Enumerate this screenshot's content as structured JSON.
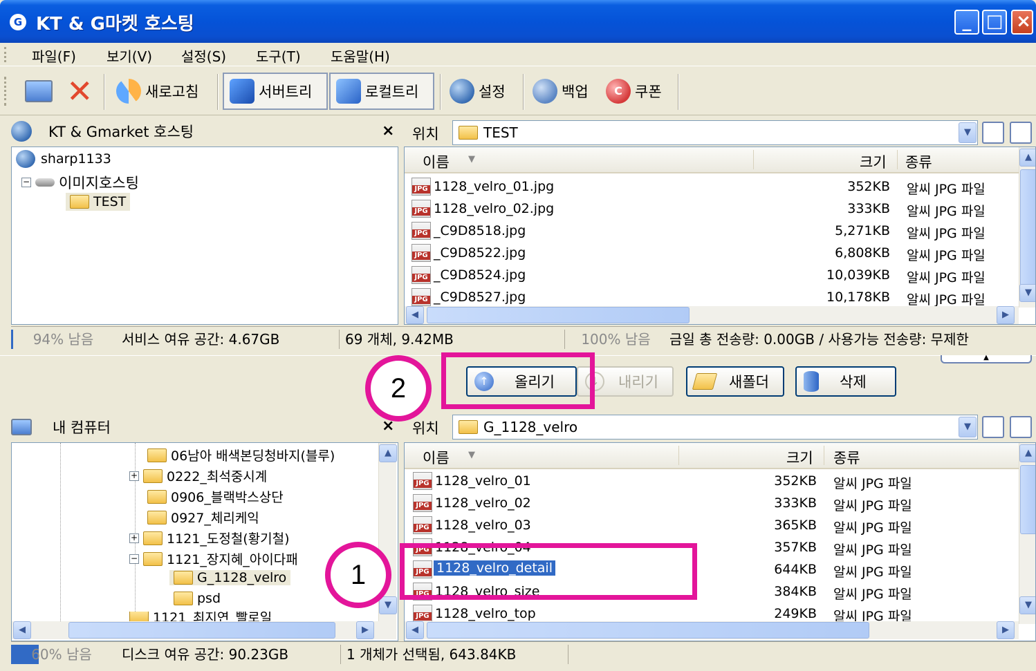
{
  "window": {
    "title": "KT & G마켓 호스팅",
    "logo": "G"
  },
  "menu": [
    "파일(F)",
    "보기(V)",
    "설정(S)",
    "도구(T)",
    "도움말(H)"
  ],
  "toolbar": {
    "refresh": "새로고침",
    "server_tree": "서버트리",
    "local_tree": "로컬트리",
    "settings": "설정",
    "backup": "백업",
    "coupon": "쿠폰",
    "coupon_icon_text": "C"
  },
  "server_panel": {
    "title": "KT & Gmarket 호스팅",
    "close": "×",
    "tree": [
      {
        "label": "sharp1133"
      },
      {
        "label": "이미지호스팅"
      },
      {
        "label": "TEST"
      }
    ]
  },
  "server_location": {
    "label": "위치",
    "value": "TEST"
  },
  "server_list": {
    "columns": {
      "name": "이름",
      "size": "크기",
      "type": "종류"
    },
    "rows": [
      {
        "name": "1128_velro_01.jpg",
        "size": "352KB",
        "type": "알씨 JPG 파일"
      },
      {
        "name": "1128_velro_02.jpg",
        "size": "333KB",
        "type": "알씨 JPG 파일"
      },
      {
        "name": "_C9D8518.jpg",
        "size": "5,271KB",
        "type": "알씨 JPG 파일"
      },
      {
        "name": "_C9D8522.jpg",
        "size": "6,808KB",
        "type": "알씨 JPG 파일"
      },
      {
        "name": "_C9D8524.jpg",
        "size": "10,039KB",
        "type": "알씨 JPG 파일"
      },
      {
        "name": "_C9D8527.jpg",
        "size": "10,178KB",
        "type": "알씨 JPG 파일"
      }
    ]
  },
  "server_status": {
    "remaining": "94% 남음",
    "free_space": "서비스 여유 공간: 4.67GB",
    "objects": "69 개체, 9.42MB",
    "transfer_remaining": "100% 남음",
    "transfer": "금일 총 전송량: 0.00GB / 사용가능 전송량: 무제한"
  },
  "actions": {
    "upload": "올리기",
    "download": "내리기",
    "new_folder": "새폴더",
    "delete": "삭제"
  },
  "local_panel": {
    "title": "내 컴퓨터",
    "close": "×",
    "tree": [
      {
        "label": "06남아 배색본딩청바지(블루)"
      },
      {
        "label": "0222_최석중시계"
      },
      {
        "label": "0906_블랙박스상단"
      },
      {
        "label": "0927_체리케익"
      },
      {
        "label": "1121_도정철(황기철)"
      },
      {
        "label": "1121_장지혜_아이다패"
      },
      {
        "label": "G_1128_velro"
      },
      {
        "label": "psd"
      },
      {
        "label": "1121_최지연_빨로일"
      }
    ]
  },
  "local_location": {
    "label": "위치",
    "value": "G_1128_velro"
  },
  "local_list": {
    "columns": {
      "name": "이름",
      "size": "크기",
      "type": "종류"
    },
    "rows": [
      {
        "name": "1128_velro_01",
        "size": "352KB",
        "type": "알씨 JPG 파일"
      },
      {
        "name": "1128_velro_02",
        "size": "333KB",
        "type": "알씨 JPG 파일"
      },
      {
        "name": "1128_velro_03",
        "size": "365KB",
        "type": "알씨 JPG 파일"
      },
      {
        "name": "1128_velro_04",
        "size": "357KB",
        "type": "알씨 JPG 파일"
      },
      {
        "name": "1128_velro_detail",
        "size": "644KB",
        "type": "알씨 JPG 파일"
      },
      {
        "name": "1128_velro_size",
        "size": "384KB",
        "type": "알씨 JPG 파일"
      },
      {
        "name": "1128_velro_top",
        "size": "249KB",
        "type": "알씨 JPG 파일"
      }
    ]
  },
  "local_status": {
    "remaining": "60% 남음",
    "remaining_fraction": 0.6,
    "free_space": "디스크 여유 공간: 90.23GB",
    "selection": "1 개체가 선택됨, 643.84KB"
  },
  "annotations": {
    "step1": "1",
    "step2": "2"
  },
  "colors": {
    "highlight": "#e3159a",
    "selection": "#316ac5",
    "titlebar": "#0a5ee0"
  }
}
